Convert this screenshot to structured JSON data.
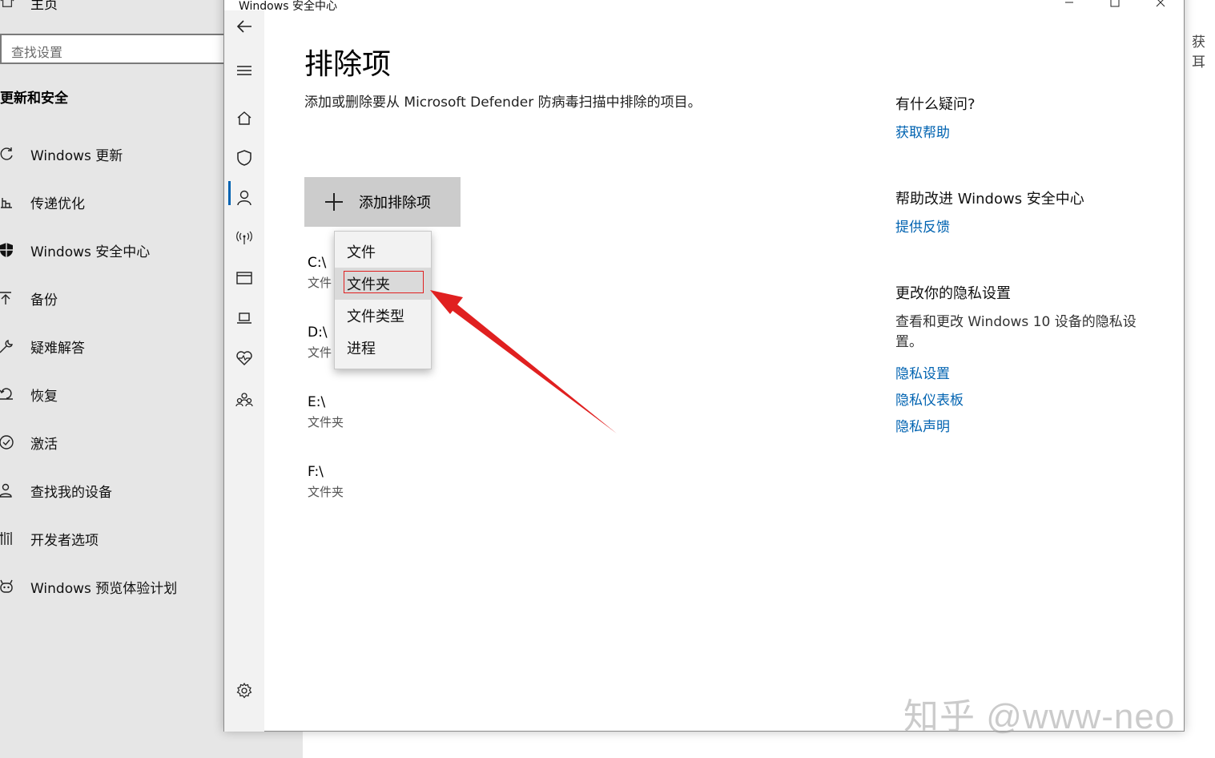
{
  "settings": {
    "home_label": "主页",
    "search_placeholder": "查找设置",
    "section_title": "更新和安全",
    "nav_items": [
      {
        "label": "Windows 更新",
        "icon": "refresh-icon"
      },
      {
        "label": "传递优化",
        "icon": "delivery-icon"
      },
      {
        "label": "Windows 安全中心",
        "icon": "shield-icon"
      },
      {
        "label": "备份",
        "icon": "backup-arrow-icon"
      },
      {
        "label": "疑难解答",
        "icon": "wrench-icon"
      },
      {
        "label": "恢复",
        "icon": "recovery-icon"
      },
      {
        "label": "激活",
        "icon": "check-circle-icon"
      },
      {
        "label": "查找我的设备",
        "icon": "person-locate-icon"
      },
      {
        "label": "开发者选项",
        "icon": "developer-icon"
      },
      {
        "label": "Windows 预览体验计划",
        "icon": "insider-icon"
      }
    ],
    "right_peek_text": "获耳"
  },
  "security_window": {
    "title": "Windows 安全中心",
    "page_title": "排除项",
    "description": "添加或删除要从 Microsoft Defender 防病毒扫描中排除的项目。",
    "add_button_label": "添加排除项",
    "exclusions": [
      {
        "path": "C:\\",
        "type": "文件"
      },
      {
        "path": "D:\\",
        "type": "文件"
      },
      {
        "path": "E:\\",
        "type": "文件夹"
      },
      {
        "path": "F:\\",
        "type": "文件夹"
      }
    ],
    "dropdown": {
      "items": [
        "文件",
        "文件夹",
        "文件类型",
        "进程"
      ],
      "highlighted_index": 1
    },
    "side_panel": {
      "question_heading": "有什么疑问?",
      "get_help_link": "获取帮助",
      "improve_heading": "帮助改进 Windows 安全中心",
      "feedback_link": "提供反馈",
      "privacy_heading": "更改你的隐私设置",
      "privacy_text": "查看和更改 Windows 10 设备的隐私设置。",
      "privacy_settings_link": "隐私设置",
      "privacy_dashboard_link": "隐私仪表板",
      "privacy_statement_link": "隐私声明"
    }
  },
  "watermark": "知乎 @www-neo",
  "colors": {
    "accent": "#0063b1",
    "annotation_red": "#e02020",
    "button_gray": "#cccccc"
  }
}
